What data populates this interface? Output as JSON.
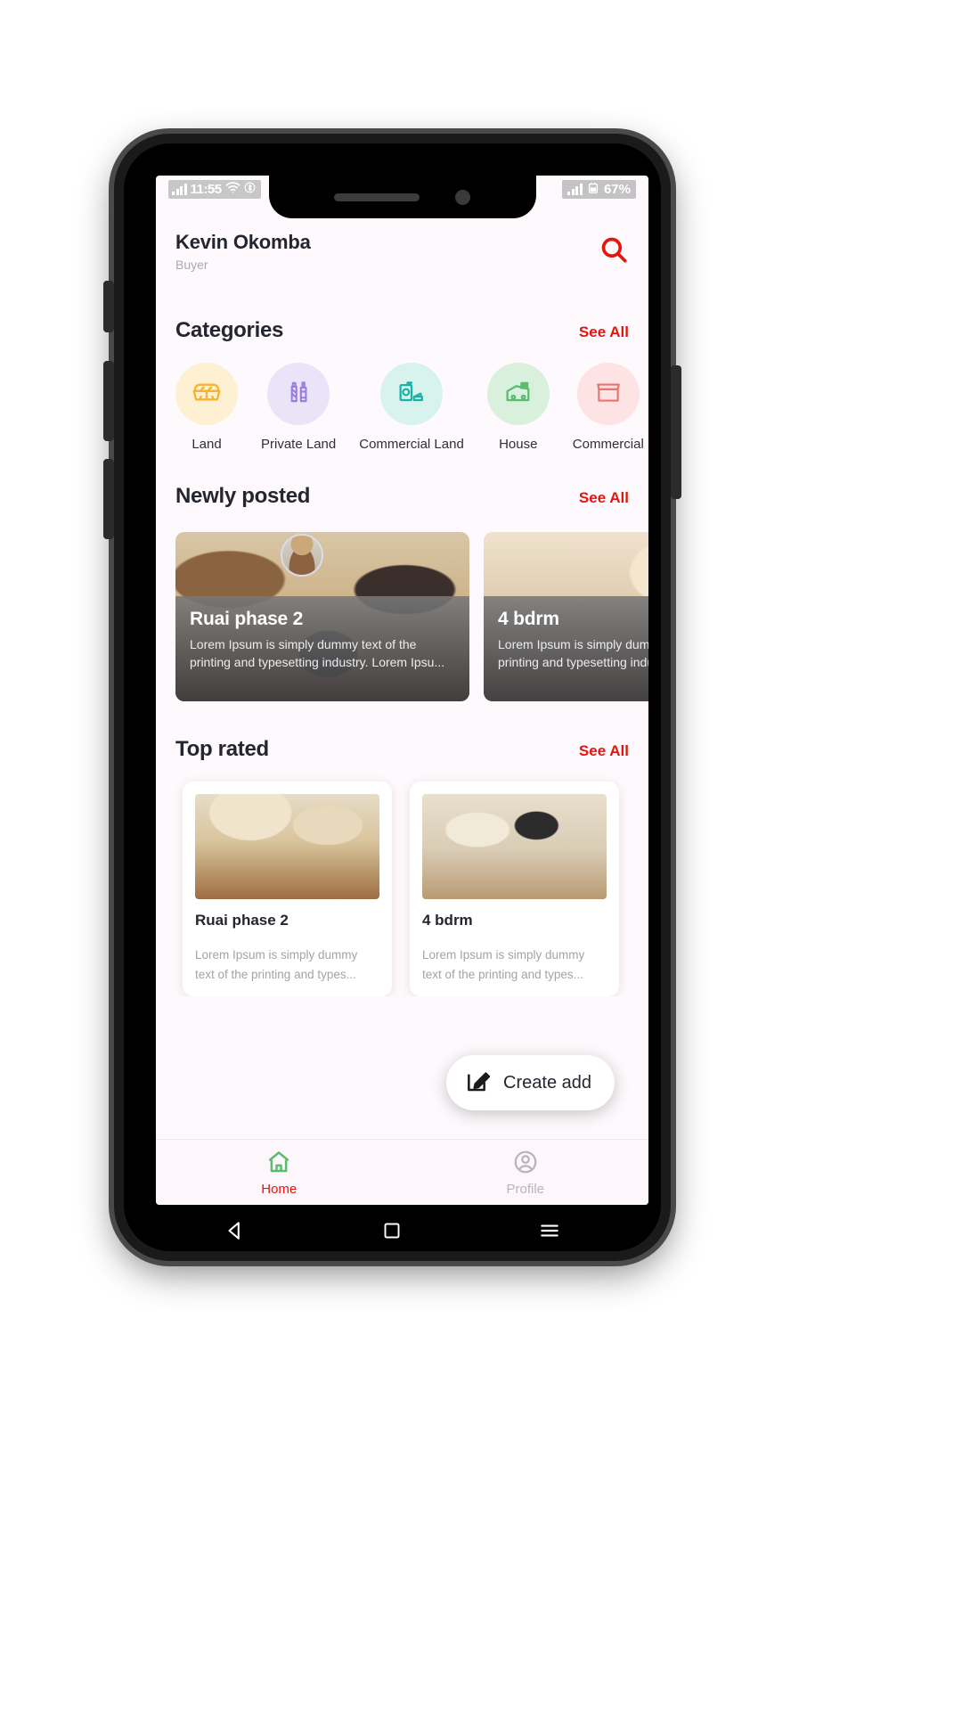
{
  "status_bar": {
    "time": "11:55",
    "wifi_icon": "wifi-icon",
    "bluetooth_icon": "bluetooth-icon",
    "signal_icon": "signal-bars-icon",
    "battery_icon": "battery-icon",
    "battery_level": "67%"
  },
  "header": {
    "user_name": "Kevin Okomba",
    "user_role": "Buyer",
    "search_icon": "search-icon",
    "accent_color": "#e8140c"
  },
  "categories": {
    "title": "Categories",
    "see_all": "See All",
    "items": [
      {
        "label": "Land",
        "icon": "egg-carton-icon",
        "bg": "#fdf0d3",
        "fg": "#f9b32d"
      },
      {
        "label": "Private Land",
        "icon": "bottles-icon",
        "bg": "#e9e4f7",
        "fg": "#9b7fe0"
      },
      {
        "label": "Commercial Land",
        "icon": "canned-food-icon",
        "bg": "#d8f2ee",
        "fg": "#18b3a5"
      },
      {
        "label": "House",
        "icon": "cash-house-icon",
        "bg": "#d9f0dd",
        "fg": "#5bbb6e"
      },
      {
        "label": "Commercial",
        "icon": "shop-icon",
        "bg": "#fde3e3",
        "fg": "#e8746f"
      }
    ]
  },
  "newly_posted": {
    "title": "Newly posted",
    "see_all": "See All",
    "avatar": "user-avatar",
    "cards": [
      {
        "title": "Ruai phase 2",
        "description": "Lorem Ipsum is simply dummy text of the printing and typesetting industry. Lorem Ipsu...",
        "image": "kitchen-interior-photo"
      },
      {
        "title": "4 bdrm",
        "description": "Lorem Ipsum is simply dummy text of the printing and typesetting industry. Lorem Ipsu...",
        "image": "living-room-interior-photo"
      }
    ]
  },
  "top_rated": {
    "title": "Top rated",
    "see_all": "See All",
    "cards": [
      {
        "title": "Ruai phase 2",
        "description": "Lorem Ipsum is simply dummy text of the printing and types...",
        "image": "kitchen-island-photo"
      },
      {
        "title": "4 bdrm",
        "description": "Lorem Ipsum is simply dummy text of the printing and types...",
        "image": "modern-living-room-photo"
      }
    ]
  },
  "fab": {
    "label": "Create add",
    "icon": "edit-square-icon"
  },
  "bottom_nav": {
    "items": [
      {
        "label": "Home",
        "icon": "home-icon",
        "active": true
      },
      {
        "label": "Profile",
        "icon": "profile-icon",
        "active": false
      }
    ]
  },
  "android_nav": {
    "back_icon": "triangle-back-icon",
    "home_icon": "square-home-icon",
    "recents_icon": "hamburger-recents-icon"
  }
}
